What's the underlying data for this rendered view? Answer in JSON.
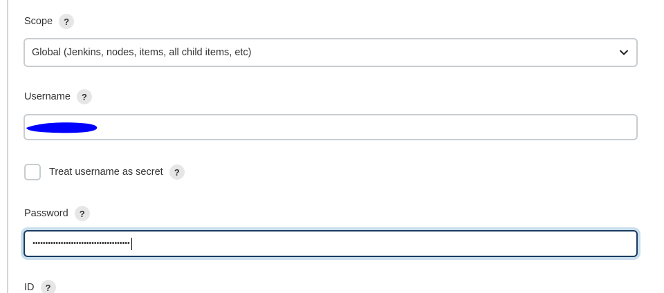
{
  "scope": {
    "label": "Scope",
    "help": "?",
    "selected": "Global (Jenkins, nodes, items, all child items, etc)"
  },
  "username": {
    "label": "Username",
    "help": "?",
    "value": ""
  },
  "treat_secret": {
    "label": "Treat username as secret",
    "help": "?",
    "checked": false
  },
  "password": {
    "label": "Password",
    "help": "?",
    "masked_value": "••••••••••••••••••••••••••••••••••••••"
  },
  "id": {
    "label": "ID",
    "help": "?"
  },
  "colors": {
    "focus_border": "#1a3a5f",
    "focus_ring": "#c9deed",
    "redaction": "#0000ff"
  }
}
